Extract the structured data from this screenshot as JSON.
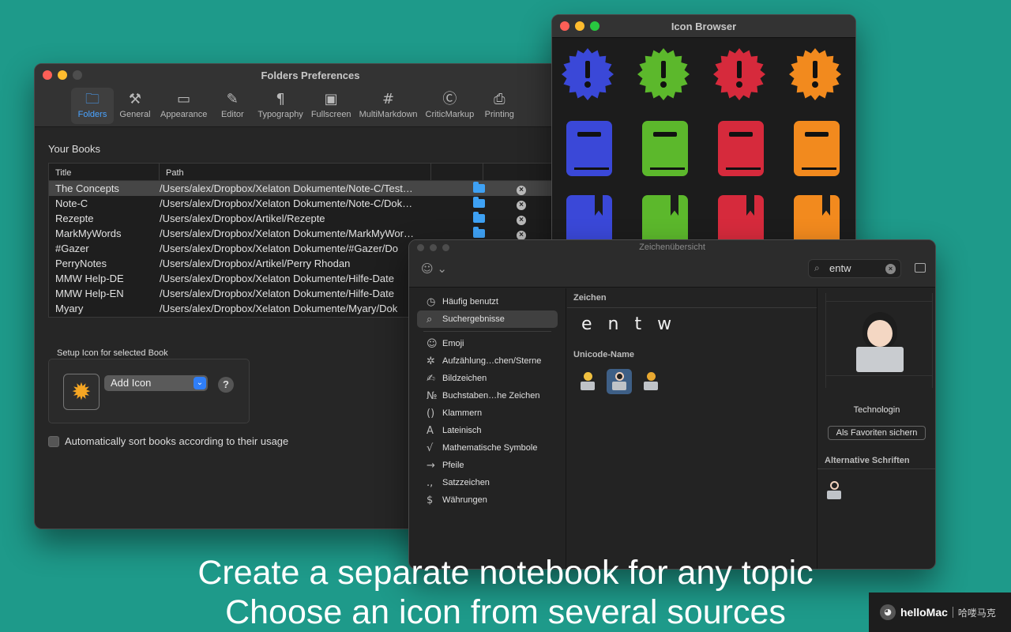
{
  "prefs": {
    "title": "Folders Preferences",
    "toolbar": [
      {
        "label": "Folders",
        "icon": "folder-icon",
        "glyph": "🗀"
      },
      {
        "label": "General",
        "icon": "tools-icon",
        "glyph": "⚒"
      },
      {
        "label": "Appearance",
        "icon": "window-icon",
        "glyph": "▭"
      },
      {
        "label": "Editor",
        "icon": "pencil-icon",
        "glyph": "✎"
      },
      {
        "label": "Typography",
        "icon": "pilcrow-icon",
        "glyph": "¶"
      },
      {
        "label": "Fullscreen",
        "icon": "fullscreen-icon",
        "glyph": "▣"
      },
      {
        "label": "MultiMarkdown",
        "icon": "hash-icon",
        "glyph": "#"
      },
      {
        "label": "CriticMarkup",
        "icon": "critic-icon",
        "glyph": "Ⓒ"
      },
      {
        "label": "Printing",
        "icon": "printer-icon",
        "glyph": "⎙"
      }
    ],
    "section_label": "Your Books",
    "columns": {
      "title": "Title",
      "path": "Path"
    },
    "books": [
      {
        "title": "The Concepts",
        "path": "/Users/alex/Dropbox/Xelaton Dokumente/Note-C/Test…"
      },
      {
        "title": "Note-C",
        "path": "/Users/alex/Dropbox/Xelaton Dokumente/Note-C/Dok…"
      },
      {
        "title": "Rezepte",
        "path": "/Users/alex/Dropbox/Artikel/Rezepte"
      },
      {
        "title": "MarkMyWords",
        "path": "/Users/alex/Dropbox/Xelaton Dokumente/MarkMyWor…"
      },
      {
        "title": "#Gazer",
        "path": "/Users/alex/Dropbox/Xelaton Dokumente/#Gazer/Do"
      },
      {
        "title": "PerryNotes",
        "path": "/Users/alex/Dropbox/Artikel/Perry Rhodan"
      },
      {
        "title": "MMW Help-DE",
        "path": "/Users/alex/Dropbox/Xelaton Dokumente/Hilfe-Date"
      },
      {
        "title": "MMW Help-EN",
        "path": "/Users/alex/Dropbox/Xelaton Dokumente/Hilfe-Date"
      },
      {
        "title": "Myary",
        "path": "/Users/alex/Dropbox/Xelaton Dokumente/Myary/Dok"
      }
    ],
    "setup_label": "Setup Icon for selected Book",
    "add_icon_label": "Add Icon",
    "help_label": "?",
    "autosort_label": "Automatically sort books according to their usage"
  },
  "icon_browser": {
    "title": "Icon Browser",
    "colors": [
      "#3a48d8",
      "#5cb82c",
      "#d62a3c",
      "#f28a1e"
    ]
  },
  "chars": {
    "title": "Zeichenübersicht",
    "search_value": "entw",
    "sidebar": [
      {
        "label": "Häufig benutzt",
        "glyph": "◷"
      },
      {
        "label": "Suchergebnisse",
        "glyph": "⌕"
      },
      {
        "label": "Emoji",
        "glyph": "☺"
      },
      {
        "label": "Aufzählung…chen/Sterne",
        "glyph": "✲"
      },
      {
        "label": "Bildzeichen",
        "glyph": "✍"
      },
      {
        "label": "Buchstaben…he Zeichen",
        "glyph": "№"
      },
      {
        "label": "Klammern",
        "glyph": "()"
      },
      {
        "label": "Lateinisch",
        "glyph": "A"
      },
      {
        "label": "Mathematische Symbole",
        "glyph": "√"
      },
      {
        "label": "Pfeile",
        "glyph": "→"
      },
      {
        "label": "Satzzeichen",
        "glyph": ".,"
      },
      {
        "label": "Währungen",
        "glyph": "$"
      }
    ],
    "zeichen_head": "Zeichen",
    "glyphs": [
      "e",
      "n",
      "t",
      "w"
    ],
    "unicode_head": "Unicode-Name",
    "char_name": "Technologin",
    "fav_button": "Als Favoriten sichern",
    "alt_head": "Alternative Schriften"
  },
  "caption": {
    "line1": "Create a separate notebook for any topic",
    "line2": "Choose an icon from several sources"
  },
  "watermark": {
    "brand": "helloMac",
    "cn": "哈喽马克"
  }
}
